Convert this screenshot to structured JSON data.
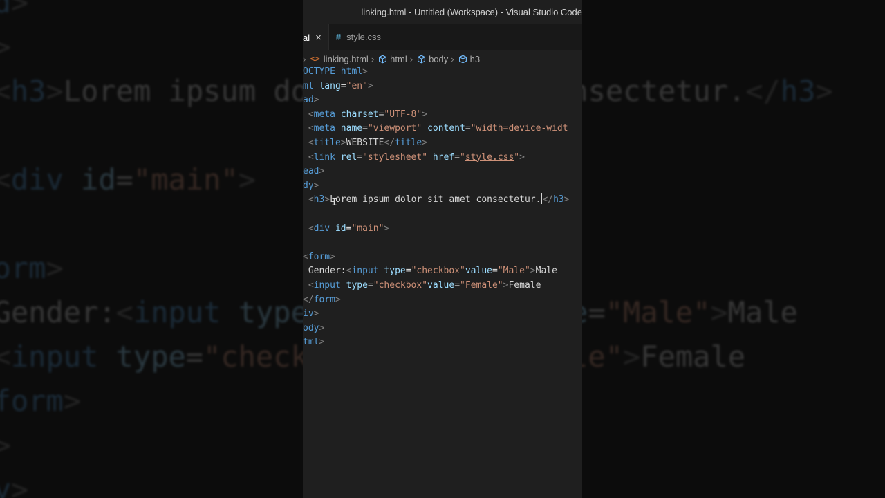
{
  "window": {
    "title": "linking.html - Untitled (Workspace) - Visual Studio Code"
  },
  "tabs": [
    {
      "label": "al",
      "close": "×",
      "active": true
    },
    {
      "label": "style.css",
      "icon": "#",
      "active": false
    }
  ],
  "breadcrumb": {
    "file": "linking.html",
    "items": [
      "html",
      "body",
      "h3"
    ]
  },
  "colors": {
    "tag": "#569cd6",
    "attribute": "#9cdcfe",
    "string": "#ce9178",
    "bracket": "#808080",
    "text": "#d4d4d4",
    "background": "#1f1f1f"
  },
  "code_lines": [
    "OCTYPE html>",
    "ml lang=\"en\">",
    "ad>",
    " <meta charset=\"UTF-8\">",
    " <meta name=\"viewport\" content=\"width=device-widt",
    " <title>WEBSITE</title>",
    " <link rel=\"stylesheet\" href=\"style.css\">",
    "ead>",
    "dy>",
    " <h3>Lorem ipsum dolor sit amet consectetur.</h3>",
    "",
    " <div id=\"main\">",
    "",
    "<form>",
    " Gender:<input type=\"checkbox\"value=\"Male\">Male",
    " <input type=\"checkbox\"value=\"Female\">Female",
    "</form>",
    "iv>",
    "ody>",
    "tml>"
  ],
  "background_lines": [
    "ead>",
    "dy>",
    "  <h3>Lorem ipsum dolor sit amet consectetur.</h3>",
    "",
    "  <div id=\"main\">",
    "",
    "<form>",
    "  Gender:<input type=\"checkbox\"value=\"Male\">Male",
    "  <input type=\"checkbox\"value=\"Female\">Female",
    "</form>",
    "iv>",
    "ody>"
  ]
}
